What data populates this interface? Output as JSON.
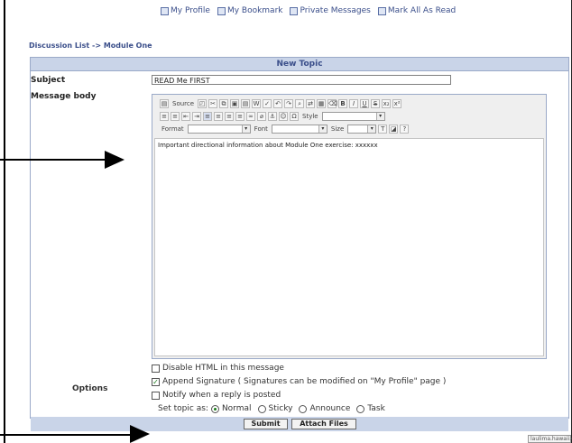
{
  "topnav": {
    "my_profile": "My Profile",
    "my_bookmark": "My Bookmark",
    "private_messages": "Private Messages",
    "mark_all_read": "Mark All As Read"
  },
  "breadcrumb": "Discussion List -> Module One",
  "panel_title": "New Topic",
  "form": {
    "subject_label": "Subject",
    "subject_value": "READ Me FIRST",
    "body_label": "Message body",
    "body_text": "Important directional information about Module One exercise: xxxxxx"
  },
  "toolbar": {
    "source_label": "Source",
    "style_label": "Style",
    "format_label": "Format",
    "font_label": "Font",
    "size_label": "Size"
  },
  "options": {
    "label": "Options",
    "disable_html": "Disable HTML in this message",
    "append_signature": "Append Signature ( Signatures can be modified on \"My Profile\" page )",
    "notify_reply": "Notify when a reply is posted",
    "set_topic_as": "Set topic as:",
    "topic_types": [
      "Normal",
      "Sticky",
      "Announce",
      "Task"
    ],
    "selected_type": "Normal"
  },
  "buttons": {
    "submit": "Submit",
    "attach_files": "Attach Files"
  },
  "status_text": "laulima.hawaii.ed"
}
